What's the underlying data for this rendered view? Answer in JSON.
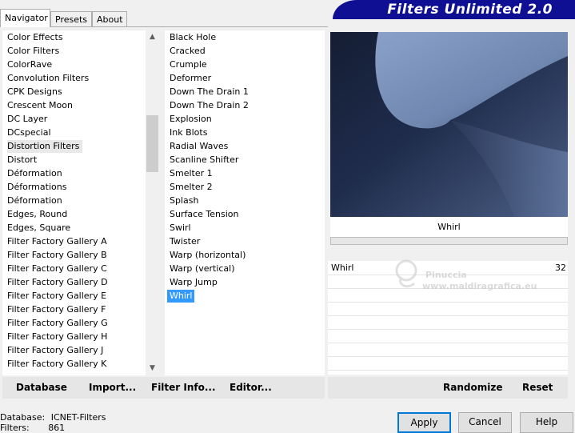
{
  "tabs": [
    {
      "label": "Navigator",
      "active": true
    },
    {
      "label": "Presets",
      "active": false
    },
    {
      "label": "About",
      "active": false
    }
  ],
  "banner": {
    "title": "Filters Unlimited 2.0",
    "color": "#0f0f94"
  },
  "categories": [
    "Color Effects",
    "Color Filters",
    "ColorRave",
    "Convolution Filters",
    "CPK Designs",
    "Crescent Moon",
    "DC Layer",
    "DCspecial",
    "Distortion Filters",
    "Distort",
    "Déformation",
    "Déformations",
    "Déformation",
    "Edges, Round",
    "Edges, Square",
    "Filter Factory Gallery A",
    "Filter Factory Gallery B",
    "Filter Factory Gallery C",
    "Filter Factory Gallery D",
    "Filter Factory Gallery E",
    "Filter Factory Gallery F",
    "Filter Factory Gallery G",
    "Filter Factory Gallery H",
    "Filter Factory Gallery J",
    "Filter Factory Gallery K"
  ],
  "selected_category": "Distortion Filters",
  "filters": [
    "Black Hole",
    "Cracked",
    "Crumple",
    "Deformer",
    "Down The Drain 1",
    "Down The Drain 2",
    "Explosion",
    "Ink Blots",
    "Radial Waves",
    "Scanline Shifter",
    "Smelter 1",
    "Smelter 2",
    "Splash",
    "Surface Tension",
    "Swirl",
    "Twister",
    "Warp (horizontal)",
    "Warp (vertical)",
    "Warp Jump",
    "Whirl"
  ],
  "selected_filter": "Whirl",
  "preview": {
    "filter_name": "Whirl"
  },
  "params": [
    {
      "name": "Whirl",
      "value": "32"
    }
  ],
  "watermark": {
    "line1": "Pinuccia",
    "line2": "www.maldiragrafica.eu"
  },
  "left_buttons": {
    "database": "Database",
    "import": "Import...",
    "filter_info": "Filter Info...",
    "editor": "Editor..."
  },
  "right_buttons": {
    "randomize": "Randomize",
    "reset": "Reset"
  },
  "status": {
    "database_label": "Database:",
    "database_value": "ICNET-Filters",
    "filters_label": "Filters:",
    "filters_value": "861"
  },
  "dialog": {
    "apply": "Apply",
    "cancel": "Cancel",
    "help": "Help"
  },
  "colors": {
    "selection": "#3399ff",
    "banner": "#0f0f94",
    "default_button_border": "#0078d7"
  }
}
